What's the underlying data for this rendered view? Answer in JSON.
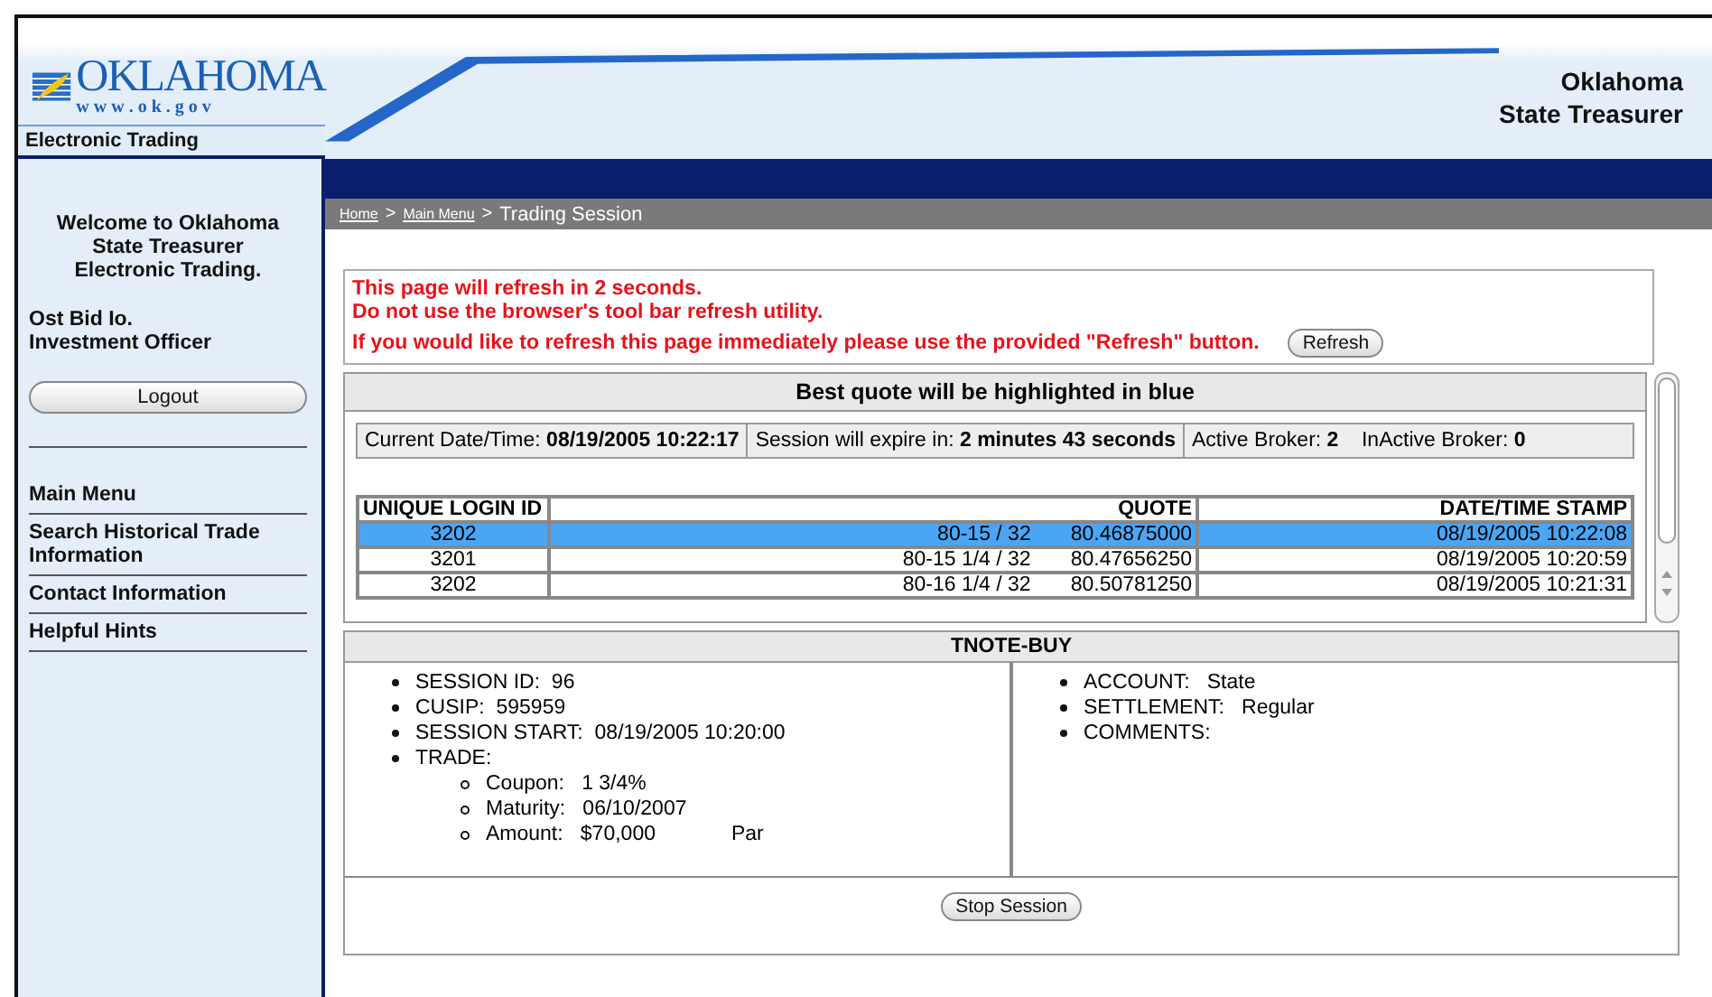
{
  "logo": {
    "name": "OKLAHOMA",
    "url": "w w w . o k . g o v"
  },
  "app_label": "Electronic Trading",
  "header_title": [
    "Oklahoma",
    "State Treasurer"
  ],
  "sidebar": {
    "welcome": [
      "Welcome to Oklahoma",
      "State Treasurer",
      "Electronic Trading."
    ],
    "user": [
      "Ost Bid Io.",
      "Investment Officer"
    ],
    "logout": "Logout",
    "items": [
      {
        "label": "Main Menu"
      },
      {
        "label": "Search Historical Trade Information"
      },
      {
        "label": "Contact Information"
      },
      {
        "label": "Helpful Hints"
      }
    ]
  },
  "breadcrumb": {
    "links": [
      "Home",
      "Main Menu"
    ],
    "separator": ">",
    "current": "Trading Session"
  },
  "notice": {
    "lines": [
      "This page will refresh in 2 seconds.",
      "Do not use the browser's tool bar refresh utility.",
      "If you would like to refresh this page immediately please use the provided \"Refresh\" button."
    ],
    "button": "Refresh"
  },
  "quotes": {
    "title": "Best quote will be highlighted in blue",
    "status": [
      {
        "label": "Current Date/Time:",
        "value": "08/19/2005 10:22:17"
      },
      {
        "label": "Session will expire in:",
        "value": "2 minutes 43 seconds"
      },
      {
        "label": "Active Broker:",
        "value": "2"
      },
      {
        "label": "InActive Broker:",
        "value": "0"
      }
    ],
    "columns": [
      "UNIQUE LOGIN ID",
      "QUOTE",
      "DATE/TIME STAMP"
    ],
    "rows": [
      {
        "id": "3202",
        "fraction": "80-15 / 32",
        "price": "80.46875000",
        "stamp": "08/19/2005 10:22:08",
        "selected": true
      },
      {
        "id": "3201",
        "fraction": "80-15 1/4 / 32",
        "price": "80.47656250",
        "stamp": "08/19/2005 10:20:59",
        "selected": false
      },
      {
        "id": "3202",
        "fraction": "80-16 1/4 / 32",
        "price": "80.50781250",
        "stamp": "08/19/2005 10:21:31",
        "selected": false
      }
    ]
  },
  "session": {
    "title": "TNOTE-BUY",
    "left": [
      {
        "label": "SESSION ID:",
        "value": "96"
      },
      {
        "label": "CUSIP:",
        "value": "595959"
      },
      {
        "label": "SESSION START:",
        "value": "08/19/2005 10:20:00"
      },
      {
        "label": "TRADE:",
        "children": [
          {
            "label": "Coupon:",
            "value": "1 3/4%"
          },
          {
            "label": "Maturity:",
            "value": "06/10/2007"
          },
          {
            "label": "Amount:",
            "value": "$70,000",
            "extra": "Par"
          }
        ]
      }
    ],
    "right": [
      {
        "label": "ACCOUNT:",
        "value": "State"
      },
      {
        "label": "SETTLEMENT:",
        "value": "Regular"
      },
      {
        "label": "COMMENTS:"
      }
    ],
    "button": "Stop Session"
  }
}
